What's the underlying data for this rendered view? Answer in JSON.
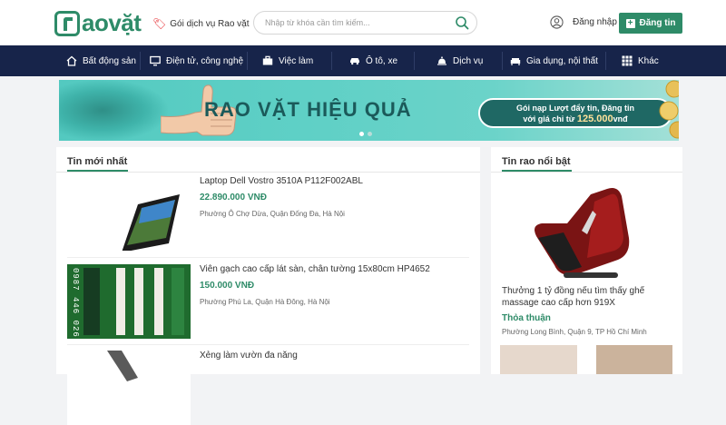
{
  "header": {
    "logo_text": "aovặt",
    "service_link": "Gói dịch vụ Rao vặt",
    "search_placeholder": "Nhập từ khóa cần tìm kiếm...",
    "login_label": "Đăng nhập",
    "post_label": "Đăng tin"
  },
  "nav": {
    "items": [
      {
        "label": "Bất động sản",
        "icon": "home-icon"
      },
      {
        "label": "Điện tử, công nghệ",
        "icon": "monitor-icon"
      },
      {
        "label": "Việc làm",
        "icon": "briefcase-icon"
      },
      {
        "label": "Ô tô, xe",
        "icon": "car-icon"
      },
      {
        "label": "Dịch vụ",
        "icon": "service-bell-icon"
      },
      {
        "label": "Gia dụng, nội thất",
        "icon": "sofa-icon"
      },
      {
        "label": "Khác",
        "icon": "grid-icon"
      }
    ]
  },
  "banner": {
    "title": "RAO VẶT HIỆU QUẢ",
    "promo_line1": "Gói nạp Lượt đẩy tin, Đăng tin",
    "promo_line2_prefix": "với giá chỉ từ ",
    "promo_price": "125.000",
    "promo_unit": "vnđ",
    "slide_count": 2,
    "active_slide": 1
  },
  "latest": {
    "title": "Tin mới nhất",
    "items": [
      {
        "title": "Laptop Dell Vostro 3510A P112F002ABL",
        "price": "22.890.000 VNĐ",
        "location": "Phường Ô Chợ Dừa, Quận Đống Đa, Hà Nội"
      },
      {
        "title": "Viên gạch cao cấp lát sàn, chân tường 15x80cm HP4652",
        "price": "150.000 VNĐ",
        "location": "Phường Phú La, Quận Hà Đông, Hà Nội",
        "thumb_text": "0987 446 026"
      },
      {
        "title": "Xẻng làm vườn đa năng",
        "price": "",
        "location": ""
      }
    ]
  },
  "featured": {
    "title": "Tin rao nổi bật",
    "item": {
      "title": "Thưởng 1 tỷ đồng nếu tìm thấy ghế massage cao cấp hơn 919X",
      "price": "Thỏa thuận",
      "location": "Phường Long Bình, Quận 9, TP Hồ Chí Minh"
    }
  },
  "colors": {
    "brand_green": "#2e8b68",
    "nav_bg": "#17244a",
    "price_green": "#2e8b68"
  }
}
